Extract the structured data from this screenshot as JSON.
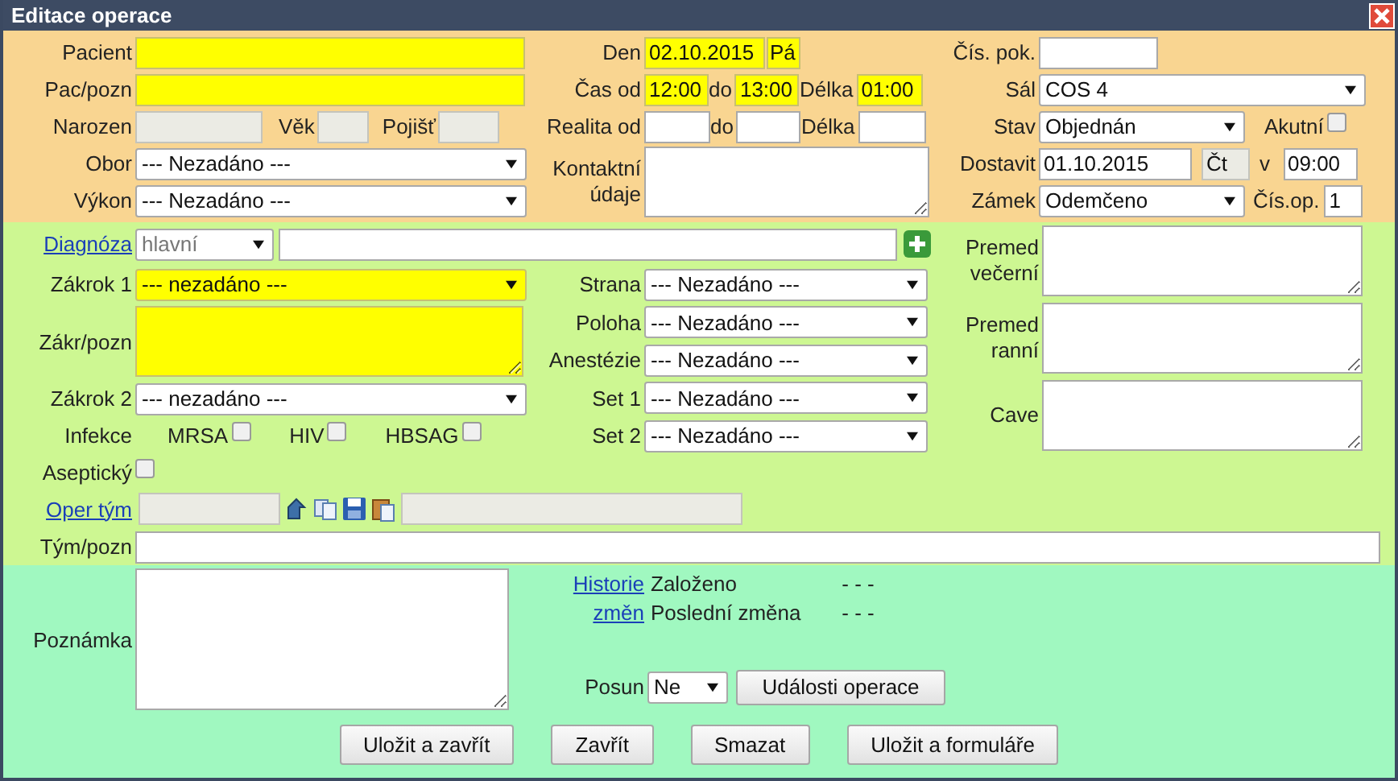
{
  "window": {
    "title": "Editace operace"
  },
  "patient": {
    "pacient": {
      "label": "Pacient",
      "highlighted": true
    },
    "pac_pozn": {
      "label": "Pac/pozn",
      "highlighted": true
    },
    "narozen": {
      "label": "Narozen",
      "disabled": true
    },
    "vek": {
      "label": "Věk",
      "disabled": true
    },
    "pojisteni": {
      "label": "Pojišť",
      "disabled": true
    },
    "obor": {
      "label": "Obor",
      "value": "--- Nezadáno ---"
    },
    "vykon": {
      "label": "Výkon",
      "value": "--- Nezadáno ---"
    }
  },
  "timing": {
    "den": {
      "label": "Den",
      "value": "02.10.2015",
      "highlighted": true
    },
    "den_weekday": {
      "value": "Pá",
      "highlighted": true
    },
    "cas_od": {
      "label": "Čas od",
      "value": "12:00",
      "highlighted": true
    },
    "cas_do": {
      "label": "do",
      "value": "13:00",
      "highlighted": true
    },
    "cas_delka": {
      "label": "Délka",
      "value": "01:00",
      "highlighted": true
    },
    "realita_od": {
      "label": "Realita od"
    },
    "realita_do": {
      "label": "do"
    },
    "realita_delka": {
      "label": "Délka"
    },
    "kontakt": {
      "label": "Kontaktní údaje"
    }
  },
  "room": {
    "cis_pok": {
      "label": "Čís. pok."
    },
    "sal": {
      "label": "Sál",
      "value": "COS 4"
    },
    "stav": {
      "label": "Stav",
      "value": "Objednán"
    },
    "akutni": {
      "label": "Akutní",
      "checked": false
    },
    "dostavit": {
      "label": "Dostavit",
      "value": "01.10.2015"
    },
    "dostavit_weekday": {
      "value": "Čt",
      "disabled": true
    },
    "dostavit_cas": {
      "label": "v",
      "value": "09:00"
    },
    "zamek": {
      "label": "Zámek",
      "value": "Odemčeno"
    },
    "cis_op": {
      "label": "Čís.op.",
      "value": "1"
    }
  },
  "diagnosis": {
    "link": "Diagnóza",
    "type": {
      "value": "hlavní",
      "disabled": true
    }
  },
  "procedure": {
    "zakrok1": {
      "label": "Zákrok 1",
      "value": "--- nezadáno ---",
      "highlighted": true
    },
    "zakr_pozn": {
      "label": "Zákr/pozn",
      "highlighted": true
    },
    "zakrok2": {
      "label": "Zákrok 2",
      "value": "--- nezadáno ---"
    }
  },
  "infections": {
    "label": "Infekce",
    "items": [
      {
        "label": "MRSA",
        "checked": false
      },
      {
        "label": "HIV",
        "checked": false
      },
      {
        "label": "HBSAG",
        "checked": false
      }
    ]
  },
  "aseptic": {
    "label": "Aseptický",
    "checked": false
  },
  "team": {
    "link": "Oper tým",
    "member": {
      "disabled": true
    },
    "detail": {
      "disabled": true
    }
  },
  "team_note": {
    "label": "Tým/pozn"
  },
  "options": [
    {
      "label": "Strana",
      "value": "--- Nezadáno ---"
    },
    {
      "label": "Poloha",
      "value": "--- Nezadáno ---"
    },
    {
      "label": "Anestézie",
      "value": "--- Nezadáno ---"
    },
    {
      "label": "Set 1",
      "value": "--- Nezadáno ---"
    },
    {
      "label": "Set 2",
      "value": "--- Nezadáno ---"
    }
  ],
  "premed": [
    {
      "label": "Premed večerní"
    },
    {
      "label": "Premed ranní"
    },
    {
      "label": "Cave"
    }
  ],
  "note": {
    "label": "Poznámka"
  },
  "history": {
    "link": "Historie změn",
    "rows": [
      {
        "label": "Založeno",
        "value": "- - -"
      },
      {
        "label": "Poslední změna",
        "value": "- - -"
      }
    ]
  },
  "posun": {
    "label": "Posun",
    "value": "Ne"
  },
  "events_button": "Události operace",
  "buttons": [
    "Uložit a zavřít",
    "Zavřít",
    "Smazat",
    "Uložit a formuláře"
  ]
}
